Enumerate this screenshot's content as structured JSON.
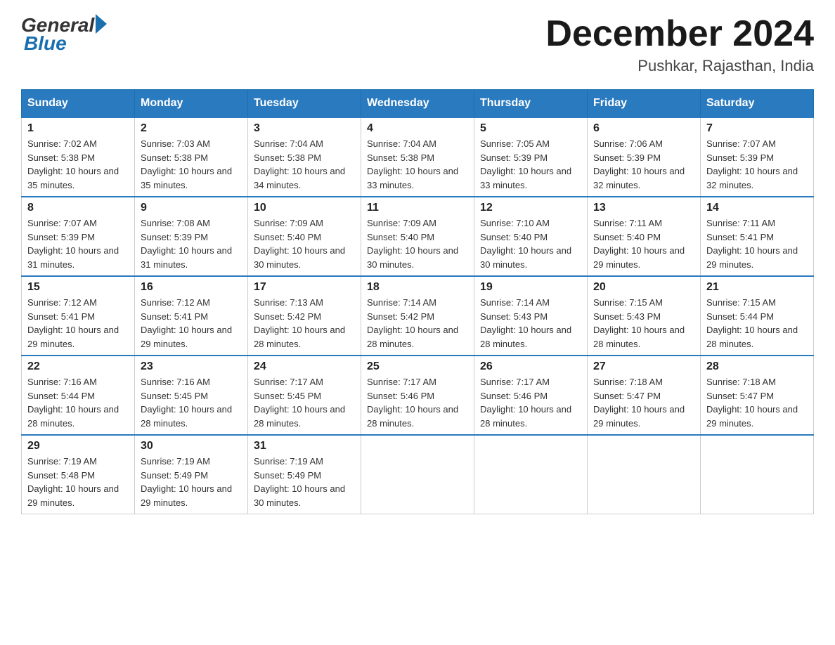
{
  "logo": {
    "general": "General",
    "blue": "Blue"
  },
  "header": {
    "title": "December 2024",
    "subtitle": "Pushkar, Rajasthan, India"
  },
  "weekdays": [
    "Sunday",
    "Monday",
    "Tuesday",
    "Wednesday",
    "Thursday",
    "Friday",
    "Saturday"
  ],
  "weeks": [
    [
      {
        "day": "1",
        "sunrise": "7:02 AM",
        "sunset": "5:38 PM",
        "daylight": "10 hours and 35 minutes."
      },
      {
        "day": "2",
        "sunrise": "7:03 AM",
        "sunset": "5:38 PM",
        "daylight": "10 hours and 35 minutes."
      },
      {
        "day": "3",
        "sunrise": "7:04 AM",
        "sunset": "5:38 PM",
        "daylight": "10 hours and 34 minutes."
      },
      {
        "day": "4",
        "sunrise": "7:04 AM",
        "sunset": "5:38 PM",
        "daylight": "10 hours and 33 minutes."
      },
      {
        "day": "5",
        "sunrise": "7:05 AM",
        "sunset": "5:39 PM",
        "daylight": "10 hours and 33 minutes."
      },
      {
        "day": "6",
        "sunrise": "7:06 AM",
        "sunset": "5:39 PM",
        "daylight": "10 hours and 32 minutes."
      },
      {
        "day": "7",
        "sunrise": "7:07 AM",
        "sunset": "5:39 PM",
        "daylight": "10 hours and 32 minutes."
      }
    ],
    [
      {
        "day": "8",
        "sunrise": "7:07 AM",
        "sunset": "5:39 PM",
        "daylight": "10 hours and 31 minutes."
      },
      {
        "day": "9",
        "sunrise": "7:08 AM",
        "sunset": "5:39 PM",
        "daylight": "10 hours and 31 minutes."
      },
      {
        "day": "10",
        "sunrise": "7:09 AM",
        "sunset": "5:40 PM",
        "daylight": "10 hours and 30 minutes."
      },
      {
        "day": "11",
        "sunrise": "7:09 AM",
        "sunset": "5:40 PM",
        "daylight": "10 hours and 30 minutes."
      },
      {
        "day": "12",
        "sunrise": "7:10 AM",
        "sunset": "5:40 PM",
        "daylight": "10 hours and 30 minutes."
      },
      {
        "day": "13",
        "sunrise": "7:11 AM",
        "sunset": "5:40 PM",
        "daylight": "10 hours and 29 minutes."
      },
      {
        "day": "14",
        "sunrise": "7:11 AM",
        "sunset": "5:41 PM",
        "daylight": "10 hours and 29 minutes."
      }
    ],
    [
      {
        "day": "15",
        "sunrise": "7:12 AM",
        "sunset": "5:41 PM",
        "daylight": "10 hours and 29 minutes."
      },
      {
        "day": "16",
        "sunrise": "7:12 AM",
        "sunset": "5:41 PM",
        "daylight": "10 hours and 29 minutes."
      },
      {
        "day": "17",
        "sunrise": "7:13 AM",
        "sunset": "5:42 PM",
        "daylight": "10 hours and 28 minutes."
      },
      {
        "day": "18",
        "sunrise": "7:14 AM",
        "sunset": "5:42 PM",
        "daylight": "10 hours and 28 minutes."
      },
      {
        "day": "19",
        "sunrise": "7:14 AM",
        "sunset": "5:43 PM",
        "daylight": "10 hours and 28 minutes."
      },
      {
        "day": "20",
        "sunrise": "7:15 AM",
        "sunset": "5:43 PM",
        "daylight": "10 hours and 28 minutes."
      },
      {
        "day": "21",
        "sunrise": "7:15 AM",
        "sunset": "5:44 PM",
        "daylight": "10 hours and 28 minutes."
      }
    ],
    [
      {
        "day": "22",
        "sunrise": "7:16 AM",
        "sunset": "5:44 PM",
        "daylight": "10 hours and 28 minutes."
      },
      {
        "day": "23",
        "sunrise": "7:16 AM",
        "sunset": "5:45 PM",
        "daylight": "10 hours and 28 minutes."
      },
      {
        "day": "24",
        "sunrise": "7:17 AM",
        "sunset": "5:45 PM",
        "daylight": "10 hours and 28 minutes."
      },
      {
        "day": "25",
        "sunrise": "7:17 AM",
        "sunset": "5:46 PM",
        "daylight": "10 hours and 28 minutes."
      },
      {
        "day": "26",
        "sunrise": "7:17 AM",
        "sunset": "5:46 PM",
        "daylight": "10 hours and 28 minutes."
      },
      {
        "day": "27",
        "sunrise": "7:18 AM",
        "sunset": "5:47 PM",
        "daylight": "10 hours and 29 minutes."
      },
      {
        "day": "28",
        "sunrise": "7:18 AM",
        "sunset": "5:47 PM",
        "daylight": "10 hours and 29 minutes."
      }
    ],
    [
      {
        "day": "29",
        "sunrise": "7:19 AM",
        "sunset": "5:48 PM",
        "daylight": "10 hours and 29 minutes."
      },
      {
        "day": "30",
        "sunrise": "7:19 AM",
        "sunset": "5:49 PM",
        "daylight": "10 hours and 29 minutes."
      },
      {
        "day": "31",
        "sunrise": "7:19 AM",
        "sunset": "5:49 PM",
        "daylight": "10 hours and 30 minutes."
      },
      null,
      null,
      null,
      null
    ]
  ]
}
